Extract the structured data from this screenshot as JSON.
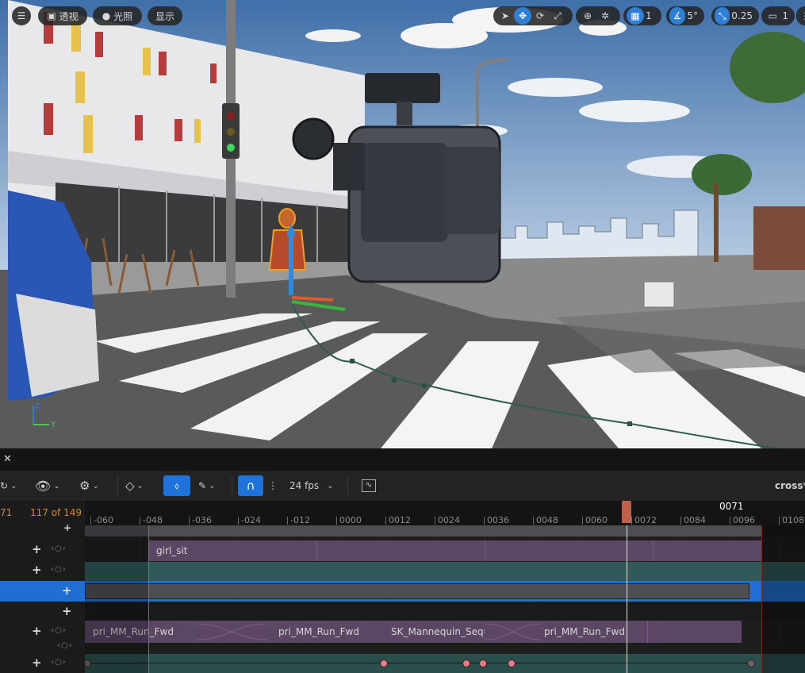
{
  "viewport": {
    "menu_icon": "hamburger-menu-icon",
    "view_mode": {
      "icon": "cube-icon",
      "label": "透视"
    },
    "lighting": {
      "icon": "sphere-icon",
      "label": "光照"
    },
    "show": {
      "label": "显示"
    },
    "transform_tools": [
      "select-arrow-icon",
      "move-icon",
      "rotate-icon",
      "scale-icon"
    ],
    "world_local_icon": "globe-icon",
    "surface_snap_icon": "surface-snap-icon",
    "grid_snap": {
      "icon": "grid-icon",
      "value": "1"
    },
    "rotation_snap": {
      "icon": "angle-icon",
      "value": "5°"
    },
    "scale_snap": {
      "icon": "scale-snap-icon",
      "value": "0.25"
    },
    "camera_speed": {
      "icon": "camera-icon",
      "value": "1"
    },
    "overflow_icon": "viewport-options-icon",
    "axis": {
      "z": "Z",
      "y": "Y"
    },
    "colors": {
      "accent": "#2f7fd6",
      "axis_z": "#2f7fd6",
      "axis_y": "#4cc94c"
    }
  },
  "sequencer": {
    "close_icon": "close-icon",
    "toolbar": {
      "keyframe_icon": "keyframe-menu-icon",
      "view_icon": "eye-icon",
      "actor_icon": "actor-gear-icon",
      "key_icon": "diamond-key-icon",
      "autokey_icon": "auto-key-icon",
      "draw_icon": "pen-icon",
      "snap_icon": "magnet-icon",
      "more_icon": "vertical-dots-icon",
      "fps": "24 fps",
      "curve_icon": "curve-editor-icon",
      "sequence_name": "cross"
    },
    "frame_current_prefix": "71",
    "frame_count": "117 of 149",
    "playhead_label": "0071",
    "ruler_labels": [
      "-060",
      "-048",
      "-036",
      "-024",
      "-012",
      "0000",
      "0012",
      "0024",
      "0036",
      "0048",
      "0060",
      "0072",
      "0084",
      "0096",
      "0108"
    ],
    "tracks": {
      "girl_sit": "girl_sit",
      "anim1": "pri_MM_Run_Fwd",
      "anim2": "pri_MM_Run_Fwd",
      "anim3": "SK_Mannequin_Sequ",
      "anim4": "pri_MM_Run_Fwd"
    },
    "key_ctl_glyph": "‹○›",
    "add_glyph": "+",
    "colors": {
      "playhead": "#c0604a",
      "selected_row": "#1f6fd2",
      "skeletal_section": "#5b4664",
      "teal_section": "#2f5a58",
      "key": "#e97b86",
      "frame_text": "#d68a2a"
    }
  }
}
